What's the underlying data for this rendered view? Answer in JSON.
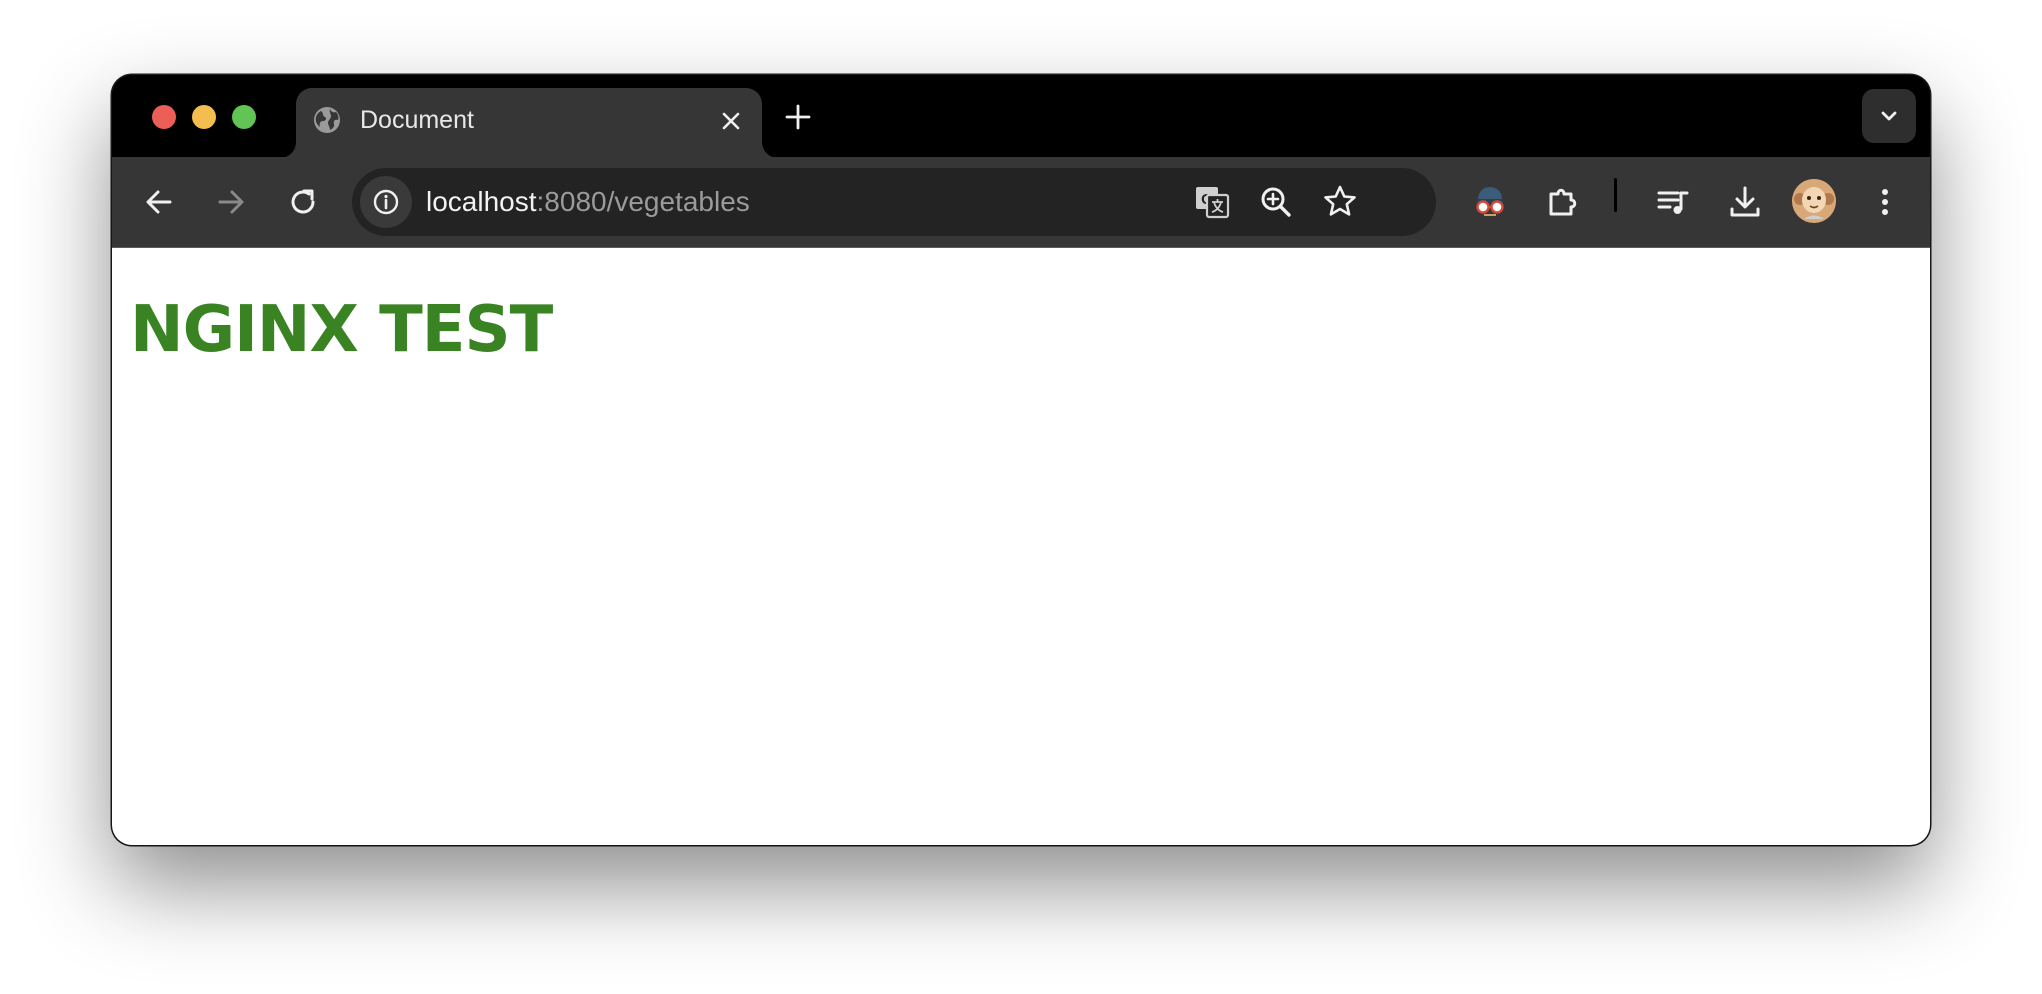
{
  "browser": {
    "tab": {
      "title": "Document",
      "favicon": "globe-icon"
    },
    "address_bar": {
      "host": "localhost",
      "path": ":8080/vegetables"
    },
    "toolbar_icons": [
      "back-icon",
      "forward-icon",
      "reload-icon",
      "site-info-icon",
      "translate-icon",
      "zoom-icon",
      "bookmark-star-icon",
      "extension-spy-icon",
      "extensions-puzzle-icon",
      "media-playlist-icon",
      "download-icon",
      "profile-avatar",
      "more-menu-icon"
    ]
  },
  "page": {
    "heading": "NGINX TEST",
    "heading_color": "#3a8323"
  },
  "colors": {
    "titlebar": "#000000",
    "toolbar": "#363636",
    "omnibox": "#232323",
    "close": "#ec5f56",
    "minimize": "#f4bd4f",
    "maximize": "#61c454"
  }
}
